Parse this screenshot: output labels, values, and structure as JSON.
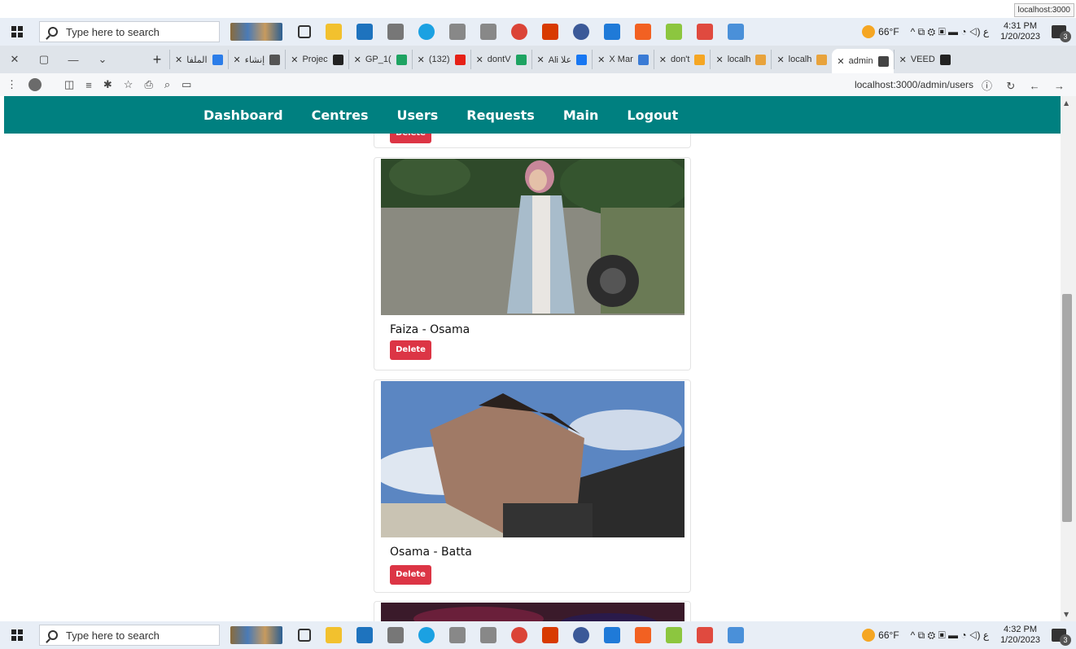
{
  "tooltip": "localhost:3000",
  "taskbar": {
    "search_placeholder": "Type here to search",
    "temp": "66°F",
    "tray_glyphs": "^ ⧉ ⚙ ▣ ▬ ◔ ◁) ع",
    "top_time": "4:31 PM",
    "bottom_time": "4:32 PM",
    "date": "1/20/2023",
    "notif_count": "3"
  },
  "tabs": [
    {
      "label": "الملفا",
      "color": "#2b7de9"
    },
    {
      "label": "إنشاء",
      "color": "#555555"
    },
    {
      "label": "Projec",
      "color": "#222222"
    },
    {
      "label": "GP_1(",
      "color": "#1ea362"
    },
    {
      "label": "(132)",
      "color": "#e62117"
    },
    {
      "label": "dontV",
      "color": "#1ea362"
    },
    {
      "label": "Ali علا",
      "color": "#1877f2"
    },
    {
      "label": "X Mar",
      "color": "#3a7bd5"
    },
    {
      "label": "don't",
      "color": "#f5a623"
    },
    {
      "label": "localh",
      "color": "#e8a33c"
    },
    {
      "label": "localh",
      "color": "#e8a33c"
    },
    {
      "label": "admin",
      "color": "#444444"
    },
    {
      "label": "VEED",
      "color": "#222222"
    }
  ],
  "address": {
    "url": "localhost:3000/admin/users"
  },
  "nav": {
    "items": [
      "Dashboard",
      "Centres",
      "Users",
      "Requests",
      "Main",
      "Logout"
    ]
  },
  "users": [
    {
      "name": "Faiza - Osama",
      "delete_label": "Delete"
    },
    {
      "name": "Osama - Batta",
      "delete_label": "Delete"
    }
  ],
  "partial_delete_label": "Delete"
}
